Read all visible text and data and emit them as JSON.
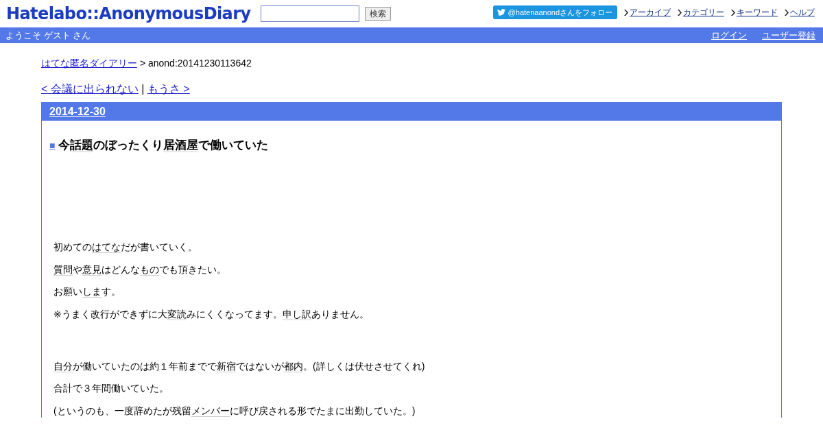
{
  "header": {
    "logo": "Hatelabo::AnonymousDiary",
    "search": {
      "button": "検索"
    },
    "follow_button": "@hatenaanondさんをフォロー",
    "links": [
      "アーカイブ",
      "カテゴリー",
      "キーワード",
      "ヘルプ"
    ]
  },
  "user_bar": {
    "welcome": "ようこそ ゲスト さん",
    "links": [
      "ログイン",
      "ユーザー登録"
    ]
  },
  "breadcrumb": {
    "link": "はてな匿名ダイアリー",
    "current": " > anond:20141230113642"
  },
  "pager": {
    "prev": "< 会議に出られない",
    "separator": " | ",
    "next": "もうさ >"
  },
  "day": {
    "date": "2014-12-30",
    "title_marker": "■",
    "title": [
      {
        "text": "今",
        "keyword": false
      },
      {
        "text": "話題",
        "keyword": true
      },
      {
        "text": "のぼったくり",
        "keyword": false
      },
      {
        "text": "居酒屋",
        "keyword": true
      },
      {
        "text": "で働いていた",
        "keyword": false
      }
    ],
    "sections": [
      [
        [
          {
            "text": "初めての",
            "keyword": false
          },
          {
            "text": "はてな",
            "keyword": true
          },
          {
            "text": "だが書いていく。",
            "keyword": false
          }
        ],
        [
          {
            "text": "質問",
            "keyword": true
          },
          {
            "text": "や",
            "keyword": false
          },
          {
            "text": "意見",
            "keyword": true
          },
          {
            "text": "はどんな",
            "keyword": false
          },
          {
            "text": "もの",
            "keyword": true
          },
          {
            "text": "でも頂きたい。",
            "keyword": false
          }
        ],
        [
          {
            "text": "お願い",
            "keyword": false
          },
          {
            "text": "しま",
            "keyword": true
          },
          {
            "text": "す。",
            "keyword": false
          }
        ],
        [
          {
            "text": "※うまく改行ができずに大",
            "keyword": false
          },
          {
            "text": "変読",
            "keyword": true
          },
          {
            "text": "みにくくなってます。",
            "keyword": false
          },
          {
            "text": "申し訳",
            "keyword": true
          },
          {
            "text": "ありません。",
            "keyword": false
          }
        ]
      ],
      [
        [
          {
            "text": "自分",
            "keyword": true
          },
          {
            "text": "が働いていたのは約１年前までで",
            "keyword": false
          },
          {
            "text": "新宿",
            "keyword": true
          },
          {
            "text": "ではないが",
            "keyword": false
          },
          {
            "text": "都内",
            "keyword": true
          },
          {
            "text": "。(詳しくは伏せさせてくれ)",
            "keyword": false
          }
        ],
        [
          {
            "text": "合計で３年間働いていた。",
            "keyword": false
          }
        ],
        [
          {
            "text": "(というのも、一度辞めたが残留",
            "keyword": false
          },
          {
            "text": "メンバー",
            "keyword": true
          },
          {
            "text": "に呼び戻される形でたまに出勤していた。)",
            "keyword": false
          }
        ]
      ]
    ]
  }
}
